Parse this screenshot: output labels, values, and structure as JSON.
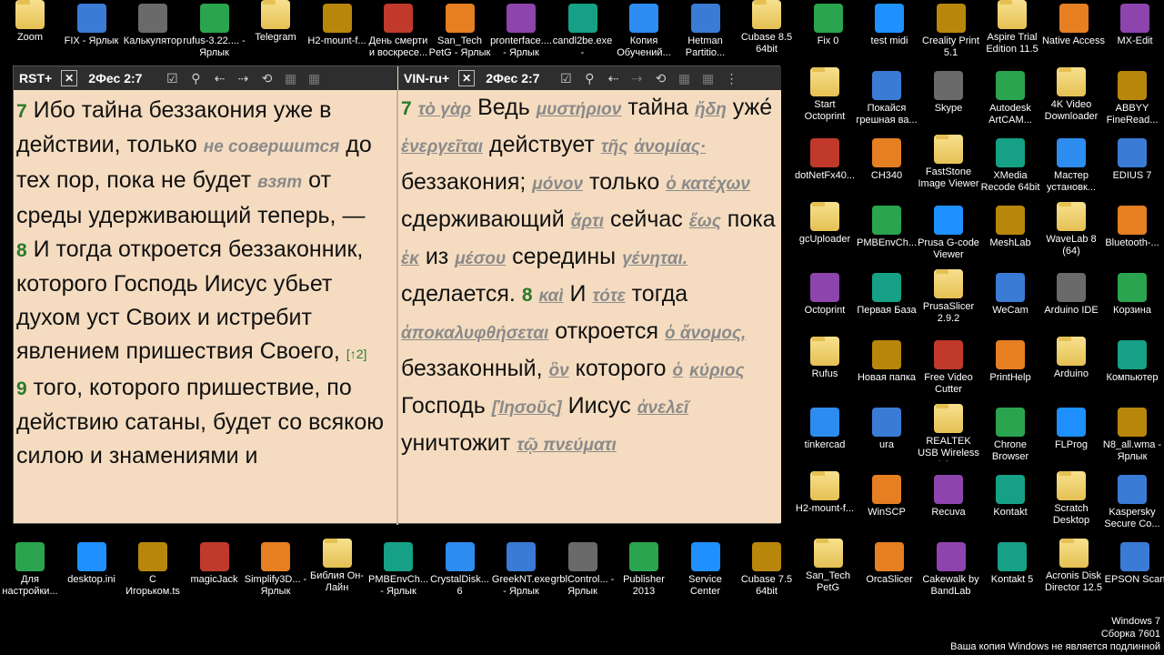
{
  "desktop": {
    "row1": [
      "Zoom",
      "FIX - Ярлык",
      "Калькулятор",
      "rufus-3.22.... - Ярлык",
      "Telegram",
      "H2-mount-f...",
      "День смерти и воскресе...",
      "San_Tech PetG - Ярлык",
      "pronterface.... - Ярлык",
      "candl2be.exe -",
      "Копия Обучений...",
      "Hetman Partitio...",
      "Cubase 8.5 64bit",
      "Fix 0",
      "test midi",
      "Creality Print 5.1",
      "Aspire Trial Edition 11.5",
      "Native Access",
      "MX-Edit"
    ],
    "col_right": [
      [
        "Start Octoprint",
        "Покайся грешная ва...",
        "Skype",
        "Autodesk ArtCAM...",
        "4K Video Downloader",
        "ABBYY FineRead..."
      ],
      [
        "dotNetFx40...",
        "CH340",
        "FastStone Image Viewer",
        "XMedia Recode 64bit",
        "Мастер установк...",
        "EDIUS 7"
      ],
      [
        "gcUploader",
        "PMBEnvCh...",
        "Prusa G-code Viewer",
        "MeshLab",
        "WaveLab 8 (64)",
        "Bluetooth-..."
      ],
      [
        "Octoprint",
        "Первая База",
        "PrusaSlicer 2.9.2",
        "WeCam",
        "Arduino IDE",
        "Корзина"
      ],
      [
        "Rufus",
        "Новая папка",
        "Free Video Cutter",
        "PrintHelp",
        "Arduino",
        "Компьютер"
      ],
      [
        "tinkercad",
        "ura",
        "REALTEK USB Wireless LA...",
        "Chrone Browser",
        "FLProg",
        "N8_all.wma - Ярлык"
      ],
      [
        "H2-mount-f...",
        "WinSCP",
        "Recuva",
        "Kontakt",
        "Scratch Desktop",
        "Kaspersky Secure Co..."
      ]
    ],
    "bottom_row": [
      "Для настройки...",
      "desktop.ini",
      "С Игорьком.ts",
      "magicJack",
      "Simplify3D... - Ярлык",
      "Библия Он-Лайн",
      "PMBEnvCh... - Ярлык",
      "CrystalDisk... 6",
      "GreekNT.exe - Ярлык",
      "grblControl... - Ярлык",
      "Publisher 2013",
      "Service Center",
      "Cubase 7.5 64bit",
      "San_Tech PetG",
      "OrcaSlicer",
      "Cakewalk by BandLab",
      "Kontakt 5",
      "Acronis Disk Director 12.5",
      "EPSON Scan"
    ]
  },
  "left_pane": {
    "module": "RST+",
    "reference": "2Фес 2:7",
    "verses": [
      {
        "num": "7",
        "text": "Ибо тайна беззакония уже в действии, только",
        "added": "не совершится",
        "text2": "до тех пор, пока не будет",
        "added2": "взят",
        "text3": "от среды удерживающий теперь, —"
      },
      {
        "num": "8",
        "text": "И тогда откроется беззаконник, которого Господь Иисус убьет духом уст Своих и истребит явлением пришествия Своего,",
        "note": "[↑2]"
      },
      {
        "num": "9",
        "text": "того, которого пришествие, по действию сатаны, будет со всякою силою и знамениями и"
      }
    ]
  },
  "right_pane": {
    "module": "VIN-ru+",
    "reference": "2Фес 2:7",
    "tokens": [
      {
        "v": "7"
      },
      {
        "g": "τὸ γὰρ"
      },
      {
        "r": "Ведь"
      },
      {
        "g": "μυστήριον"
      },
      {
        "r": "тайна"
      },
      {
        "g": "ἤδη"
      },
      {
        "r": "уже́"
      },
      {
        "g": "ἐνεργεῖται"
      },
      {
        "r": "действует"
      },
      {
        "g": "τῆς"
      },
      {
        "g": "ἀνομίας·"
      },
      {
        "r": "беззакония;"
      },
      {
        "g": "μόνον"
      },
      {
        "r": "только"
      },
      {
        "g": "ὁ κατέχων"
      },
      {
        "r": "сдерживающий"
      },
      {
        "g": "ἄρτι"
      },
      {
        "r": "сейчас"
      },
      {
        "g": "ἕως"
      },
      {
        "r": "пока"
      },
      {
        "g": "ἐκ"
      },
      {
        "r": "из"
      },
      {
        "g": "μέσου"
      },
      {
        "r": "середины"
      },
      {
        "g": "γένηται."
      },
      {
        "r": "сделается."
      },
      {
        "v": "8"
      },
      {
        "g": "καὶ"
      },
      {
        "r": "И"
      },
      {
        "g": "τότε"
      },
      {
        "r": "тогда"
      },
      {
        "g": "ἀποκαλυφθήσεται"
      },
      {
        "r": "откроется"
      },
      {
        "g": "ὁ ἄνομος,"
      },
      {
        "r": "беззаконный,"
      },
      {
        "g": "ὃν"
      },
      {
        "r": "которого"
      },
      {
        "g": "ὁ"
      },
      {
        "g": "κύριος"
      },
      {
        "r": "Господь"
      },
      {
        "g": "[Ἰησοῦς]"
      },
      {
        "r": "Иисус"
      },
      {
        "g": "ἀνελεῖ"
      },
      {
        "r": "уничтожит"
      },
      {
        "g": "τῷ πνεύματι"
      }
    ]
  },
  "watermark": {
    "line1": "Windows 7",
    "line2": "Сборка 7601",
    "line3": "Ваша копия Windows не является подлинной"
  },
  "colors": {
    "panel_bg": "#f5dcc0",
    "toolbar_bg": "#2e2e2e",
    "verse_num": "#2a7a2a",
    "greek": "#8a8a8a"
  }
}
